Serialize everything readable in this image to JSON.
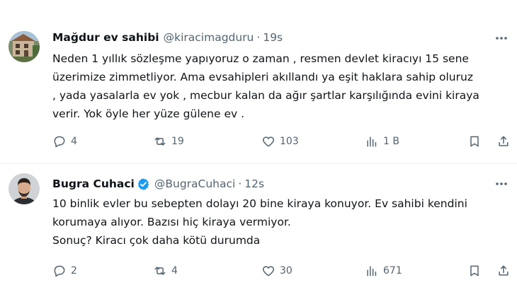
{
  "tweets": [
    {
      "name": "Mağdur ev sahibi",
      "handle": "@kiracimagduru",
      "separator": "·",
      "time": "19s",
      "verified": false,
      "text": "Neden 1 yıllık sözleşme yapıyoruz o zaman , resmen devlet kiracıyı 15 sene\nüzerimize zimmetliyor. Ama evsahipleri akıllandı ya eşit haklara sahip oluruz\n, yada yasalarla ev yok , mecbur kalan da ağır şartlar karşılığında evini kiraya\nverir. Yok öyle her yüze gülene ev .",
      "replies": "4",
      "retweets": "19",
      "likes": "103",
      "views": "1 B"
    },
    {
      "name": "Bugra Cuhaci",
      "handle": "@BugraCuhaci",
      "separator": "·",
      "time": "12s",
      "verified": true,
      "text": "10 binlik evler bu sebepten dolayı 20 bine kiraya konuyor. Ev sahibi kendini\nkorumaya alıyor. Bazısı hiç kiraya vermiyor.\nSonuç? Kiracı çok daha kötü durumda",
      "replies": "2",
      "retweets": "4",
      "likes": "30",
      "views": "671"
    }
  ],
  "icons": {
    "reply": "reply-icon",
    "retweet": "retweet-icon",
    "like": "heart-icon",
    "views": "views-icon",
    "bookmark": "bookmark-icon",
    "share": "share-icon",
    "more": "more-icon",
    "verified": "verified-badge-icon"
  },
  "colors": {
    "text": "#0f1419",
    "secondary": "#536471",
    "verified": "#1d9bf0",
    "divider": "#eff3f4"
  }
}
